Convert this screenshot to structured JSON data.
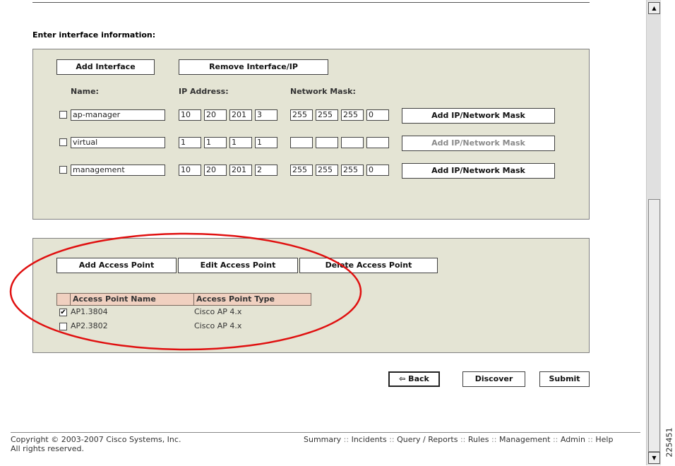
{
  "section_title": "Enter interface information:",
  "interface_panel": {
    "add_interface": "Add Interface",
    "remove_interface": "Remove Interface/IP",
    "col_name": "Name:",
    "col_ip": "IP Address:",
    "col_mask": "Network Mask:",
    "rows": [
      {
        "name": "ap-manager",
        "ip": [
          "10",
          "20",
          "201",
          "3"
        ],
        "mask": [
          "255",
          "255",
          "255",
          "0"
        ],
        "btn": "Add IP/Network Mask"
      },
      {
        "name": "virtual",
        "ip": [
          "1",
          "1",
          "1",
          "1"
        ],
        "mask": [
          "",
          "",
          "",
          ""
        ],
        "btn": "Add IP/Network Mask"
      },
      {
        "name": "management",
        "ip": [
          "10",
          "20",
          "201",
          "2"
        ],
        "mask": [
          "255",
          "255",
          "255",
          "0"
        ],
        "btn": "Add IP/Network Mask"
      }
    ]
  },
  "ap_panel": {
    "add_ap": "Add Access Point",
    "edit_ap": "Edit Access Point",
    "delete_ap": "Delete Access Point",
    "col_name": "Access Point Name",
    "col_type": "Access Point Type",
    "rows": [
      {
        "name": "AP1.3804",
        "type": "Cisco AP 4.x",
        "checked": true
      },
      {
        "name": "AP2.3802",
        "type": "Cisco AP 4.x",
        "checked": false
      }
    ]
  },
  "actions": {
    "back": "⇦ Back",
    "discover": "Discover",
    "submit": "Submit"
  },
  "footer": {
    "copyright": "Copyright © 2003-2007 Cisco Systems, Inc.",
    "rights": "All rights reserved.",
    "nav": [
      "Summary",
      "Incidents",
      "Query / Reports",
      "Rules",
      "Management",
      "Admin",
      "Help"
    ],
    "separator": "::"
  },
  "figure_id": "225451",
  "annotation_color": "#e01010",
  "scroll_up_icon": "triangle-up",
  "scroll_down_icon": "triangle-down"
}
